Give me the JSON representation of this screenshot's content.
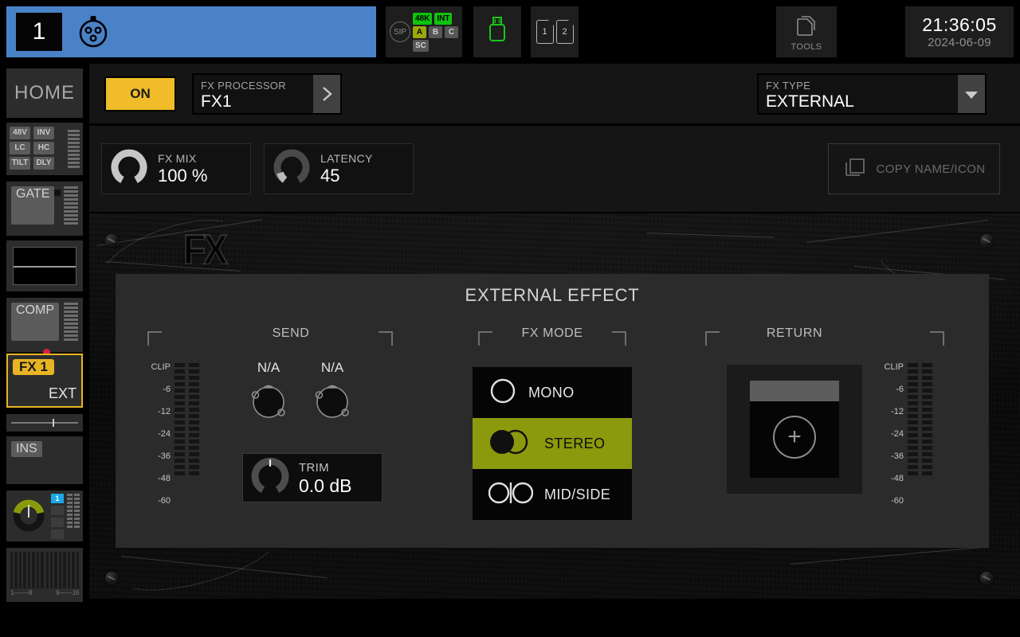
{
  "topbar": {
    "channel": {
      "number": "1",
      "icon": "xlr-connector-icon",
      "color": "#4a82c8"
    },
    "status": {
      "sip": "SIP",
      "badges": [
        {
          "label": "48K",
          "state": "green"
        },
        {
          "label": "INT",
          "state": "green"
        },
        {
          "label": "A",
          "state": "olive"
        },
        {
          "label": "B",
          "state": "grey"
        },
        {
          "label": "C",
          "state": "grey"
        },
        {
          "label": "SC",
          "state": "grey"
        }
      ]
    },
    "usb": {
      "icon": "usb-drive-icon",
      "color": "#19c419"
    },
    "sdcards": [
      "1",
      "2"
    ],
    "tools": {
      "label": "TOOLS",
      "icon": "pages-icon"
    },
    "clock": {
      "time": "21:36:05",
      "date": "2024-06-09"
    }
  },
  "sidebar": {
    "home": "HOME",
    "flags": [
      "48V",
      "INV",
      "LC",
      "HC",
      "TILT",
      "DLY"
    ],
    "gate": "GATE",
    "comp": "COMP",
    "fx": {
      "tag": "FX 1",
      "mode": "EXT"
    },
    "ins": "INS",
    "pan_channel": "1",
    "bars_scale_left": "1--------8",
    "bars_scale_right": "9-------16"
  },
  "fx_header": {
    "on_label": "ON",
    "processor": {
      "caption": "FX PROCESSOR",
      "value": "FX1",
      "arrow": "chevron-right-icon"
    },
    "type": {
      "caption": "FX TYPE",
      "value": "EXTERNAL",
      "arrow": "chevron-down-icon"
    }
  },
  "fx_params": {
    "mix": {
      "caption": "FX MIX",
      "value": "100 %",
      "knob_pct": 100
    },
    "latency": {
      "caption": "LATENCY",
      "value": "45",
      "knob_pct": 8
    },
    "copy": {
      "label": "COPY NAME/ICON",
      "icon": "copy-icon"
    }
  },
  "stage": {
    "watermark": "FX"
  },
  "panel": {
    "title": "EXTERNAL EFFECT",
    "send": {
      "title": "SEND",
      "meter_labels": [
        "CLIP",
        "-6",
        "-12",
        "-24",
        "-36",
        "-48",
        "-60"
      ],
      "outputs": [
        "N/A",
        "N/A"
      ],
      "trim": {
        "caption": "TRIM",
        "value": "0.0 dB"
      }
    },
    "fx_mode": {
      "title": "FX MODE",
      "selected": "STEREO",
      "options": [
        {
          "label": "MONO",
          "icon": "circle-outline-icon"
        },
        {
          "label": "STEREO",
          "icon": "two-circles-icon"
        },
        {
          "label": "MID-SIDE-icon",
          "label_text": "MID/SIDE"
        }
      ],
      "option_labels": [
        "MONO",
        "STEREO",
        "MID/SIDE"
      ]
    },
    "return": {
      "title": "RETURN",
      "meter_labels": [
        "CLIP",
        "-6",
        "-12",
        "-24",
        "-36",
        "-48",
        "-60"
      ],
      "add_icon": "plus-circle-icon"
    }
  },
  "colors": {
    "accent_yellow": "#f0bc29",
    "accent_olive": "#8a9a0c",
    "accent_blue": "#4a82c8",
    "accent_green": "#0ec40e",
    "accent_cyan": "#1ba7e8",
    "led_red": "#e0203c"
  }
}
